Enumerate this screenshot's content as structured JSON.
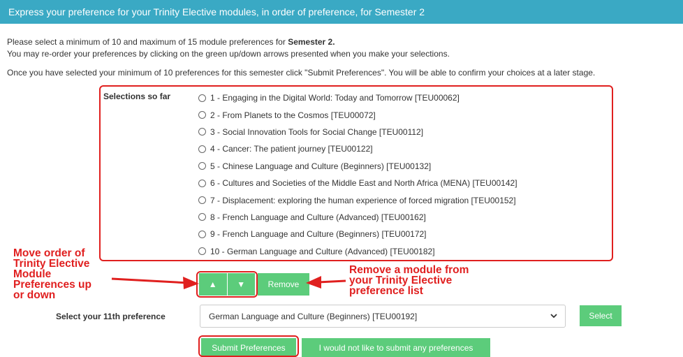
{
  "header": {
    "title": "Express your preference for your Trinity Elective modules, in order of preference, for Semester 2"
  },
  "instructions": {
    "line1_prefix": "Please select a minimum of 10 and maximum of 15 module preferences for ",
    "line1_bold": "Semester 2.",
    "line2": "You may re-order your preferences by clicking on the green up/down arrows presented when you make your selections.",
    "line3": "Once you have selected your minimum of 10 preferences for this semester click \"Submit Preferences\". You will be able to confirm your choices at a later stage."
  },
  "selections": {
    "label": "Selections so far",
    "items": [
      "1 - Engaging in the Digital World: Today and Tomorrow [TEU00062]",
      "2 - From Planets to the Cosmos [TEU00072]",
      "3 - Social Innovation Tools for Social Change [TEU00112]",
      "4 - Cancer: The patient journey [TEU00122]",
      "5 - Chinese Language and Culture (Beginners) [TEU00132]",
      "6 - Cultures and Societies of the Middle East and North Africa (MENA) [TEU00142]",
      "7 - Displacement: exploring the human experience of forced migration [TEU00152]",
      "8 - French Language and Culture (Advanced) [TEU00162]",
      "9 - French Language and Culture (Beginners) [TEU00172]",
      "10 - German Language and Culture (Advanced) [TEU00182]"
    ]
  },
  "controls": {
    "up_label": "▲",
    "down_label": "▼",
    "remove_label": "Remove"
  },
  "next_preference": {
    "label": "Select your 11th preference",
    "selected_value": "German Language and Culture (Beginners) [TEU00192]",
    "select_button": "Select"
  },
  "actions": {
    "submit_label": "Submit Preferences",
    "decline_label": "I would not like to submit any preferences"
  },
  "annotations": {
    "reorder": [
      "Move order of",
      "Trinity Elective",
      "Module",
      "Preferences up",
      "or down"
    ],
    "remove": [
      "Remove a module from",
      "your Trinity Elective",
      "preference list"
    ]
  },
  "colors": {
    "header_bg": "#3aa9c4",
    "button_green": "#5ccc7b",
    "annotation_red": "#e0201f"
  }
}
